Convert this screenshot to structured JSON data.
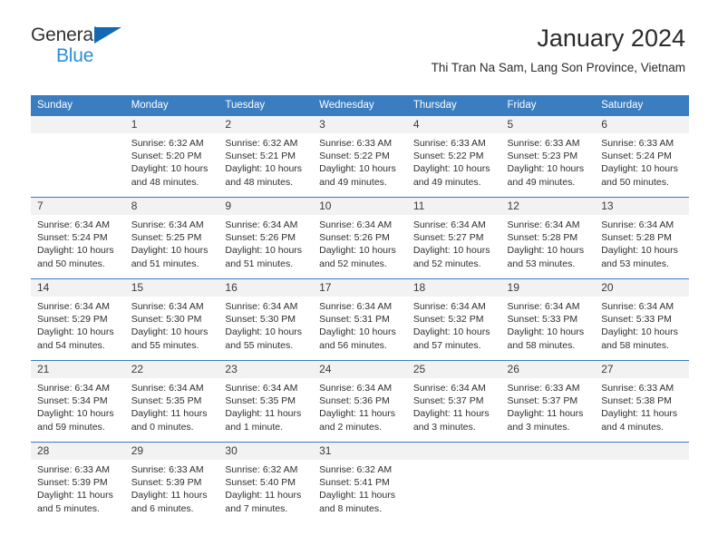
{
  "brand": {
    "line1": "General",
    "line2": "Blue",
    "triangle_color": "#1268b3",
    "line2_color": "#2a8fd4"
  },
  "header": {
    "title": "January 2024",
    "subtitle": "Thi Tran Na Sam, Lang Son Province, Vietnam"
  },
  "theme": {
    "header_blue": "#3a7dc0",
    "daynum_bg": "#f2f2f2",
    "text": "#2e2e2e"
  },
  "weekdays": [
    "Sunday",
    "Monday",
    "Tuesday",
    "Wednesday",
    "Thursday",
    "Friday",
    "Saturday"
  ],
  "weeks": [
    [
      {
        "day": ""
      },
      {
        "day": "1",
        "sunrise": "Sunrise: 6:32 AM",
        "sunset": "Sunset: 5:20 PM",
        "daylight": "Daylight: 10 hours and 48 minutes."
      },
      {
        "day": "2",
        "sunrise": "Sunrise: 6:32 AM",
        "sunset": "Sunset: 5:21 PM",
        "daylight": "Daylight: 10 hours and 48 minutes."
      },
      {
        "day": "3",
        "sunrise": "Sunrise: 6:33 AM",
        "sunset": "Sunset: 5:22 PM",
        "daylight": "Daylight: 10 hours and 49 minutes."
      },
      {
        "day": "4",
        "sunrise": "Sunrise: 6:33 AM",
        "sunset": "Sunset: 5:22 PM",
        "daylight": "Daylight: 10 hours and 49 minutes."
      },
      {
        "day": "5",
        "sunrise": "Sunrise: 6:33 AM",
        "sunset": "Sunset: 5:23 PM",
        "daylight": "Daylight: 10 hours and 49 minutes."
      },
      {
        "day": "6",
        "sunrise": "Sunrise: 6:33 AM",
        "sunset": "Sunset: 5:24 PM",
        "daylight": "Daylight: 10 hours and 50 minutes."
      }
    ],
    [
      {
        "day": "7",
        "sunrise": "Sunrise: 6:34 AM",
        "sunset": "Sunset: 5:24 PM",
        "daylight": "Daylight: 10 hours and 50 minutes."
      },
      {
        "day": "8",
        "sunrise": "Sunrise: 6:34 AM",
        "sunset": "Sunset: 5:25 PM",
        "daylight": "Daylight: 10 hours and 51 minutes."
      },
      {
        "day": "9",
        "sunrise": "Sunrise: 6:34 AM",
        "sunset": "Sunset: 5:26 PM",
        "daylight": "Daylight: 10 hours and 51 minutes."
      },
      {
        "day": "10",
        "sunrise": "Sunrise: 6:34 AM",
        "sunset": "Sunset: 5:26 PM",
        "daylight": "Daylight: 10 hours and 52 minutes."
      },
      {
        "day": "11",
        "sunrise": "Sunrise: 6:34 AM",
        "sunset": "Sunset: 5:27 PM",
        "daylight": "Daylight: 10 hours and 52 minutes."
      },
      {
        "day": "12",
        "sunrise": "Sunrise: 6:34 AM",
        "sunset": "Sunset: 5:28 PM",
        "daylight": "Daylight: 10 hours and 53 minutes."
      },
      {
        "day": "13",
        "sunrise": "Sunrise: 6:34 AM",
        "sunset": "Sunset: 5:28 PM",
        "daylight": "Daylight: 10 hours and 53 minutes."
      }
    ],
    [
      {
        "day": "14",
        "sunrise": "Sunrise: 6:34 AM",
        "sunset": "Sunset: 5:29 PM",
        "daylight": "Daylight: 10 hours and 54 minutes."
      },
      {
        "day": "15",
        "sunrise": "Sunrise: 6:34 AM",
        "sunset": "Sunset: 5:30 PM",
        "daylight": "Daylight: 10 hours and 55 minutes."
      },
      {
        "day": "16",
        "sunrise": "Sunrise: 6:34 AM",
        "sunset": "Sunset: 5:30 PM",
        "daylight": "Daylight: 10 hours and 55 minutes."
      },
      {
        "day": "17",
        "sunrise": "Sunrise: 6:34 AM",
        "sunset": "Sunset: 5:31 PM",
        "daylight": "Daylight: 10 hours and 56 minutes."
      },
      {
        "day": "18",
        "sunrise": "Sunrise: 6:34 AM",
        "sunset": "Sunset: 5:32 PM",
        "daylight": "Daylight: 10 hours and 57 minutes."
      },
      {
        "day": "19",
        "sunrise": "Sunrise: 6:34 AM",
        "sunset": "Sunset: 5:33 PM",
        "daylight": "Daylight: 10 hours and 58 minutes."
      },
      {
        "day": "20",
        "sunrise": "Sunrise: 6:34 AM",
        "sunset": "Sunset: 5:33 PM",
        "daylight": "Daylight: 10 hours and 58 minutes."
      }
    ],
    [
      {
        "day": "21",
        "sunrise": "Sunrise: 6:34 AM",
        "sunset": "Sunset: 5:34 PM",
        "daylight": "Daylight: 10 hours and 59 minutes."
      },
      {
        "day": "22",
        "sunrise": "Sunrise: 6:34 AM",
        "sunset": "Sunset: 5:35 PM",
        "daylight": "Daylight: 11 hours and 0 minutes."
      },
      {
        "day": "23",
        "sunrise": "Sunrise: 6:34 AM",
        "sunset": "Sunset: 5:35 PM",
        "daylight": "Daylight: 11 hours and 1 minute."
      },
      {
        "day": "24",
        "sunrise": "Sunrise: 6:34 AM",
        "sunset": "Sunset: 5:36 PM",
        "daylight": "Daylight: 11 hours and 2 minutes."
      },
      {
        "day": "25",
        "sunrise": "Sunrise: 6:34 AM",
        "sunset": "Sunset: 5:37 PM",
        "daylight": "Daylight: 11 hours and 3 minutes."
      },
      {
        "day": "26",
        "sunrise": "Sunrise: 6:33 AM",
        "sunset": "Sunset: 5:37 PM",
        "daylight": "Daylight: 11 hours and 3 minutes."
      },
      {
        "day": "27",
        "sunrise": "Sunrise: 6:33 AM",
        "sunset": "Sunset: 5:38 PM",
        "daylight": "Daylight: 11 hours and 4 minutes."
      }
    ],
    [
      {
        "day": "28",
        "sunrise": "Sunrise: 6:33 AM",
        "sunset": "Sunset: 5:39 PM",
        "daylight": "Daylight: 11 hours and 5 minutes."
      },
      {
        "day": "29",
        "sunrise": "Sunrise: 6:33 AM",
        "sunset": "Sunset: 5:39 PM",
        "daylight": "Daylight: 11 hours and 6 minutes."
      },
      {
        "day": "30",
        "sunrise": "Sunrise: 6:32 AM",
        "sunset": "Sunset: 5:40 PM",
        "daylight": "Daylight: 11 hours and 7 minutes."
      },
      {
        "day": "31",
        "sunrise": "Sunrise: 6:32 AM",
        "sunset": "Sunset: 5:41 PM",
        "daylight": "Daylight: 11 hours and 8 minutes."
      },
      {
        "day": ""
      },
      {
        "day": ""
      },
      {
        "day": ""
      }
    ]
  ]
}
